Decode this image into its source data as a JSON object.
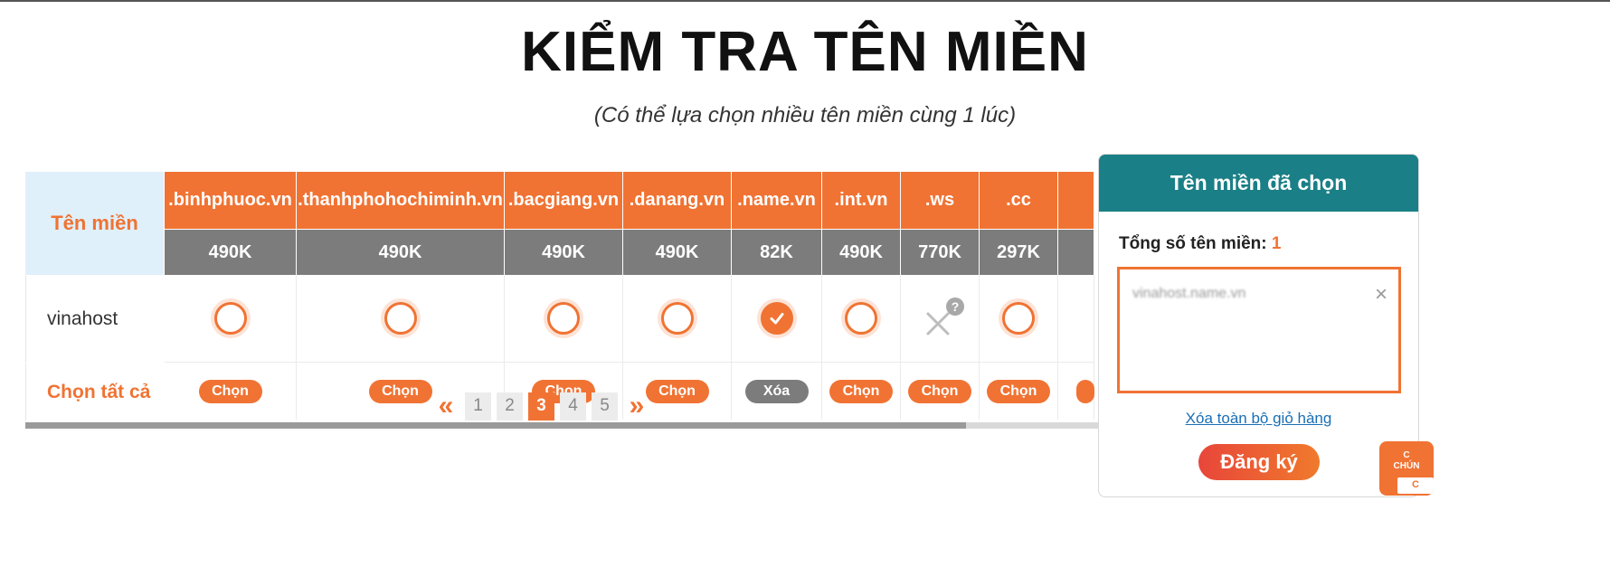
{
  "page": {
    "title": "KIỂM TRA TÊN MIỀN",
    "subtitle": "(Có thể lựa chọn nhiều tên miền cùng 1 lúc)"
  },
  "table": {
    "label_header": "Tên miền",
    "row_name": "vinahost",
    "select_all_label": "Chọn tất cả",
    "columns": [
      {
        "ext": ".binhphuoc.vn",
        "price": "490K",
        "state": "available",
        "action": "Chọn"
      },
      {
        "ext": ".thanhphohochiminh.vn",
        "price": "490K",
        "state": "available",
        "action": "Chọn"
      },
      {
        "ext": ".bacgiang.vn",
        "price": "490K",
        "state": "available",
        "action": "Chọn"
      },
      {
        "ext": ".danang.vn",
        "price": "490K",
        "state": "available",
        "action": "Chọn"
      },
      {
        "ext": ".name.vn",
        "price": "82K",
        "state": "selected",
        "action": "Xóa"
      },
      {
        "ext": ".int.vn",
        "price": "490K",
        "state": "available",
        "action": "Chọn"
      },
      {
        "ext": ".ws",
        "price": "770K",
        "state": "unavailable",
        "action": "Chọn"
      },
      {
        "ext": ".cc",
        "price": "297K",
        "state": "available",
        "action": "Chọn"
      },
      {
        "ext": "",
        "price": "",
        "state": "none",
        "action": ""
      }
    ]
  },
  "pagination": {
    "prev": "«",
    "next": "»",
    "pages": [
      "1",
      "2",
      "3",
      "4",
      "5"
    ],
    "current": "3"
  },
  "cart": {
    "header": "Tên miền đã chọn",
    "count_label": "Tổng số tên miền:",
    "count": "1",
    "items": [
      "vinahost.name.vn"
    ],
    "close_glyph": "×",
    "clear_label": "Xóa toàn bộ giỏ hàng",
    "register_label": "Đăng ký"
  },
  "floating_badge": {
    "line1": "C",
    "line2": "CHÚN",
    "inner": "C"
  },
  "colors": {
    "accent": "#f07333",
    "price_bg": "#7c7c7c",
    "cart_header": "#1a7f86",
    "label_bg": "#dff0fb"
  }
}
